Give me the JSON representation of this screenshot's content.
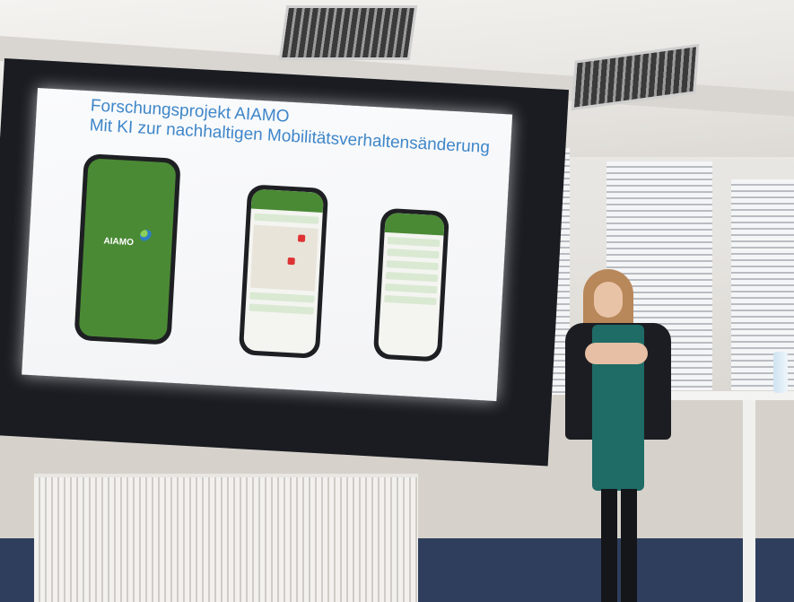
{
  "slide": {
    "title_line1": "Forschungsprojekt AIAMO",
    "title_line2": "Mit KI zur nachhaltigen Mobilitätsverhaltensänderung",
    "logo_text": "AIAMO"
  }
}
